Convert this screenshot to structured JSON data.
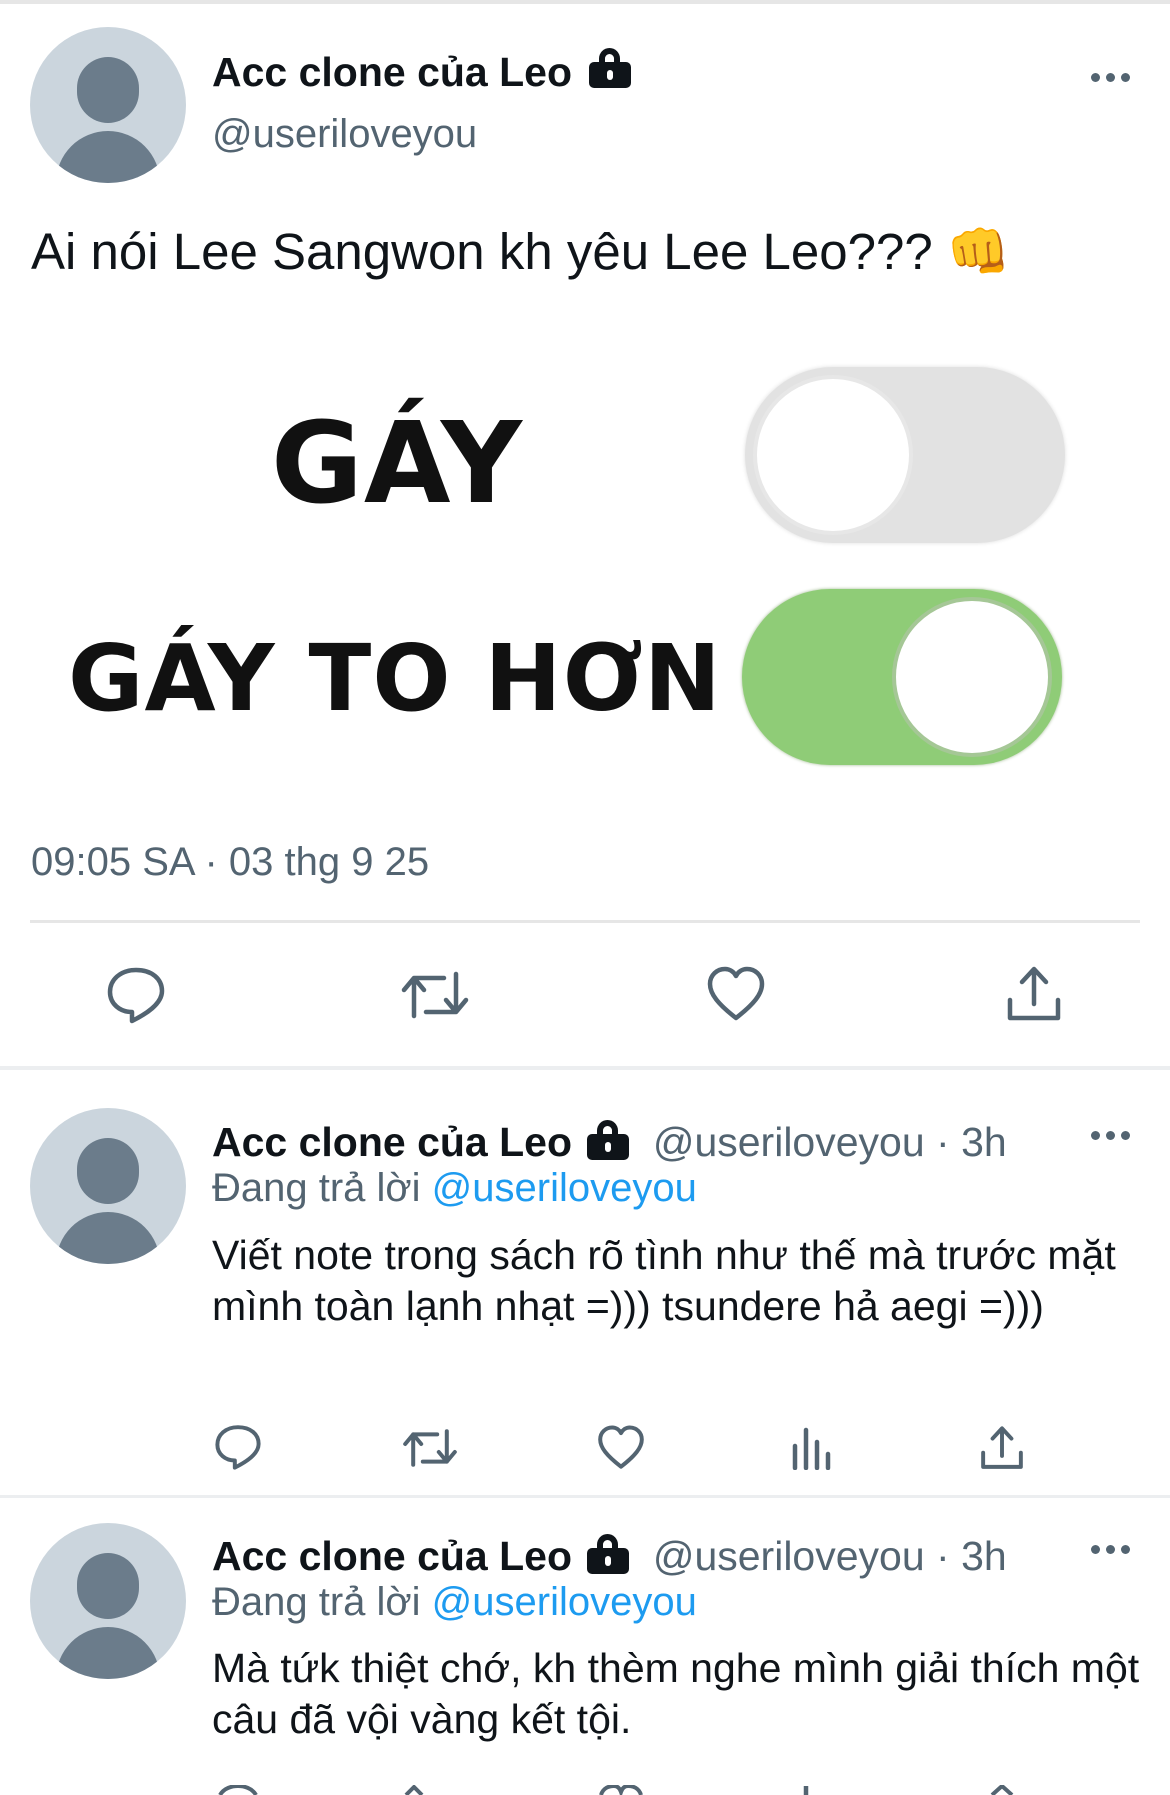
{
  "main_tweet": {
    "display_name": "Acc clone của Leo",
    "handle": "@useriloveyou",
    "text": "Ai nói Lee Sangwon kh yêu Lee Leo??? 👊",
    "meme": {
      "label_top": "GÁY",
      "label_bottom": "GÁY TO HƠN",
      "toggle_top": "off",
      "toggle_bottom": "on",
      "toggle_on_color": "#8fcc77",
      "toggle_off_color": "#e2e2e2"
    },
    "timestamp": "09:05 SA · 03 thg 9 25",
    "actions": [
      "reply-icon",
      "retweet-icon",
      "like-icon",
      "share-icon"
    ]
  },
  "replies": [
    {
      "display_name": "Acc clone của Leo",
      "handle_time": "@useriloveyou · 3h",
      "replying_prefix": "Đang trả lời",
      "replying_to": "@useriloveyou",
      "text": "Viết note trong sách rõ tình như thế mà trước mặt mình toàn lạnh nhạt =))) tsundere hả aegi =)))",
      "actions": [
        "reply-icon",
        "retweet-icon",
        "like-icon",
        "analytics-icon",
        "share-icon"
      ]
    },
    {
      "display_name": "Acc clone của Leo",
      "handle_time": "@useriloveyou · 3h",
      "replying_prefix": "Đang trả lời",
      "replying_to": "@useriloveyou",
      "text": "Mà tứk thiệt chớ, kh thèm nghe mình giải thích một câu đã vội vàng kết tội."
    }
  ],
  "colors": {
    "text": "#0f1419",
    "muted": "#536471",
    "link": "#1d9bf0",
    "avatar_bg": "#cbd5dd",
    "avatar_fg": "#6b7c8b"
  }
}
